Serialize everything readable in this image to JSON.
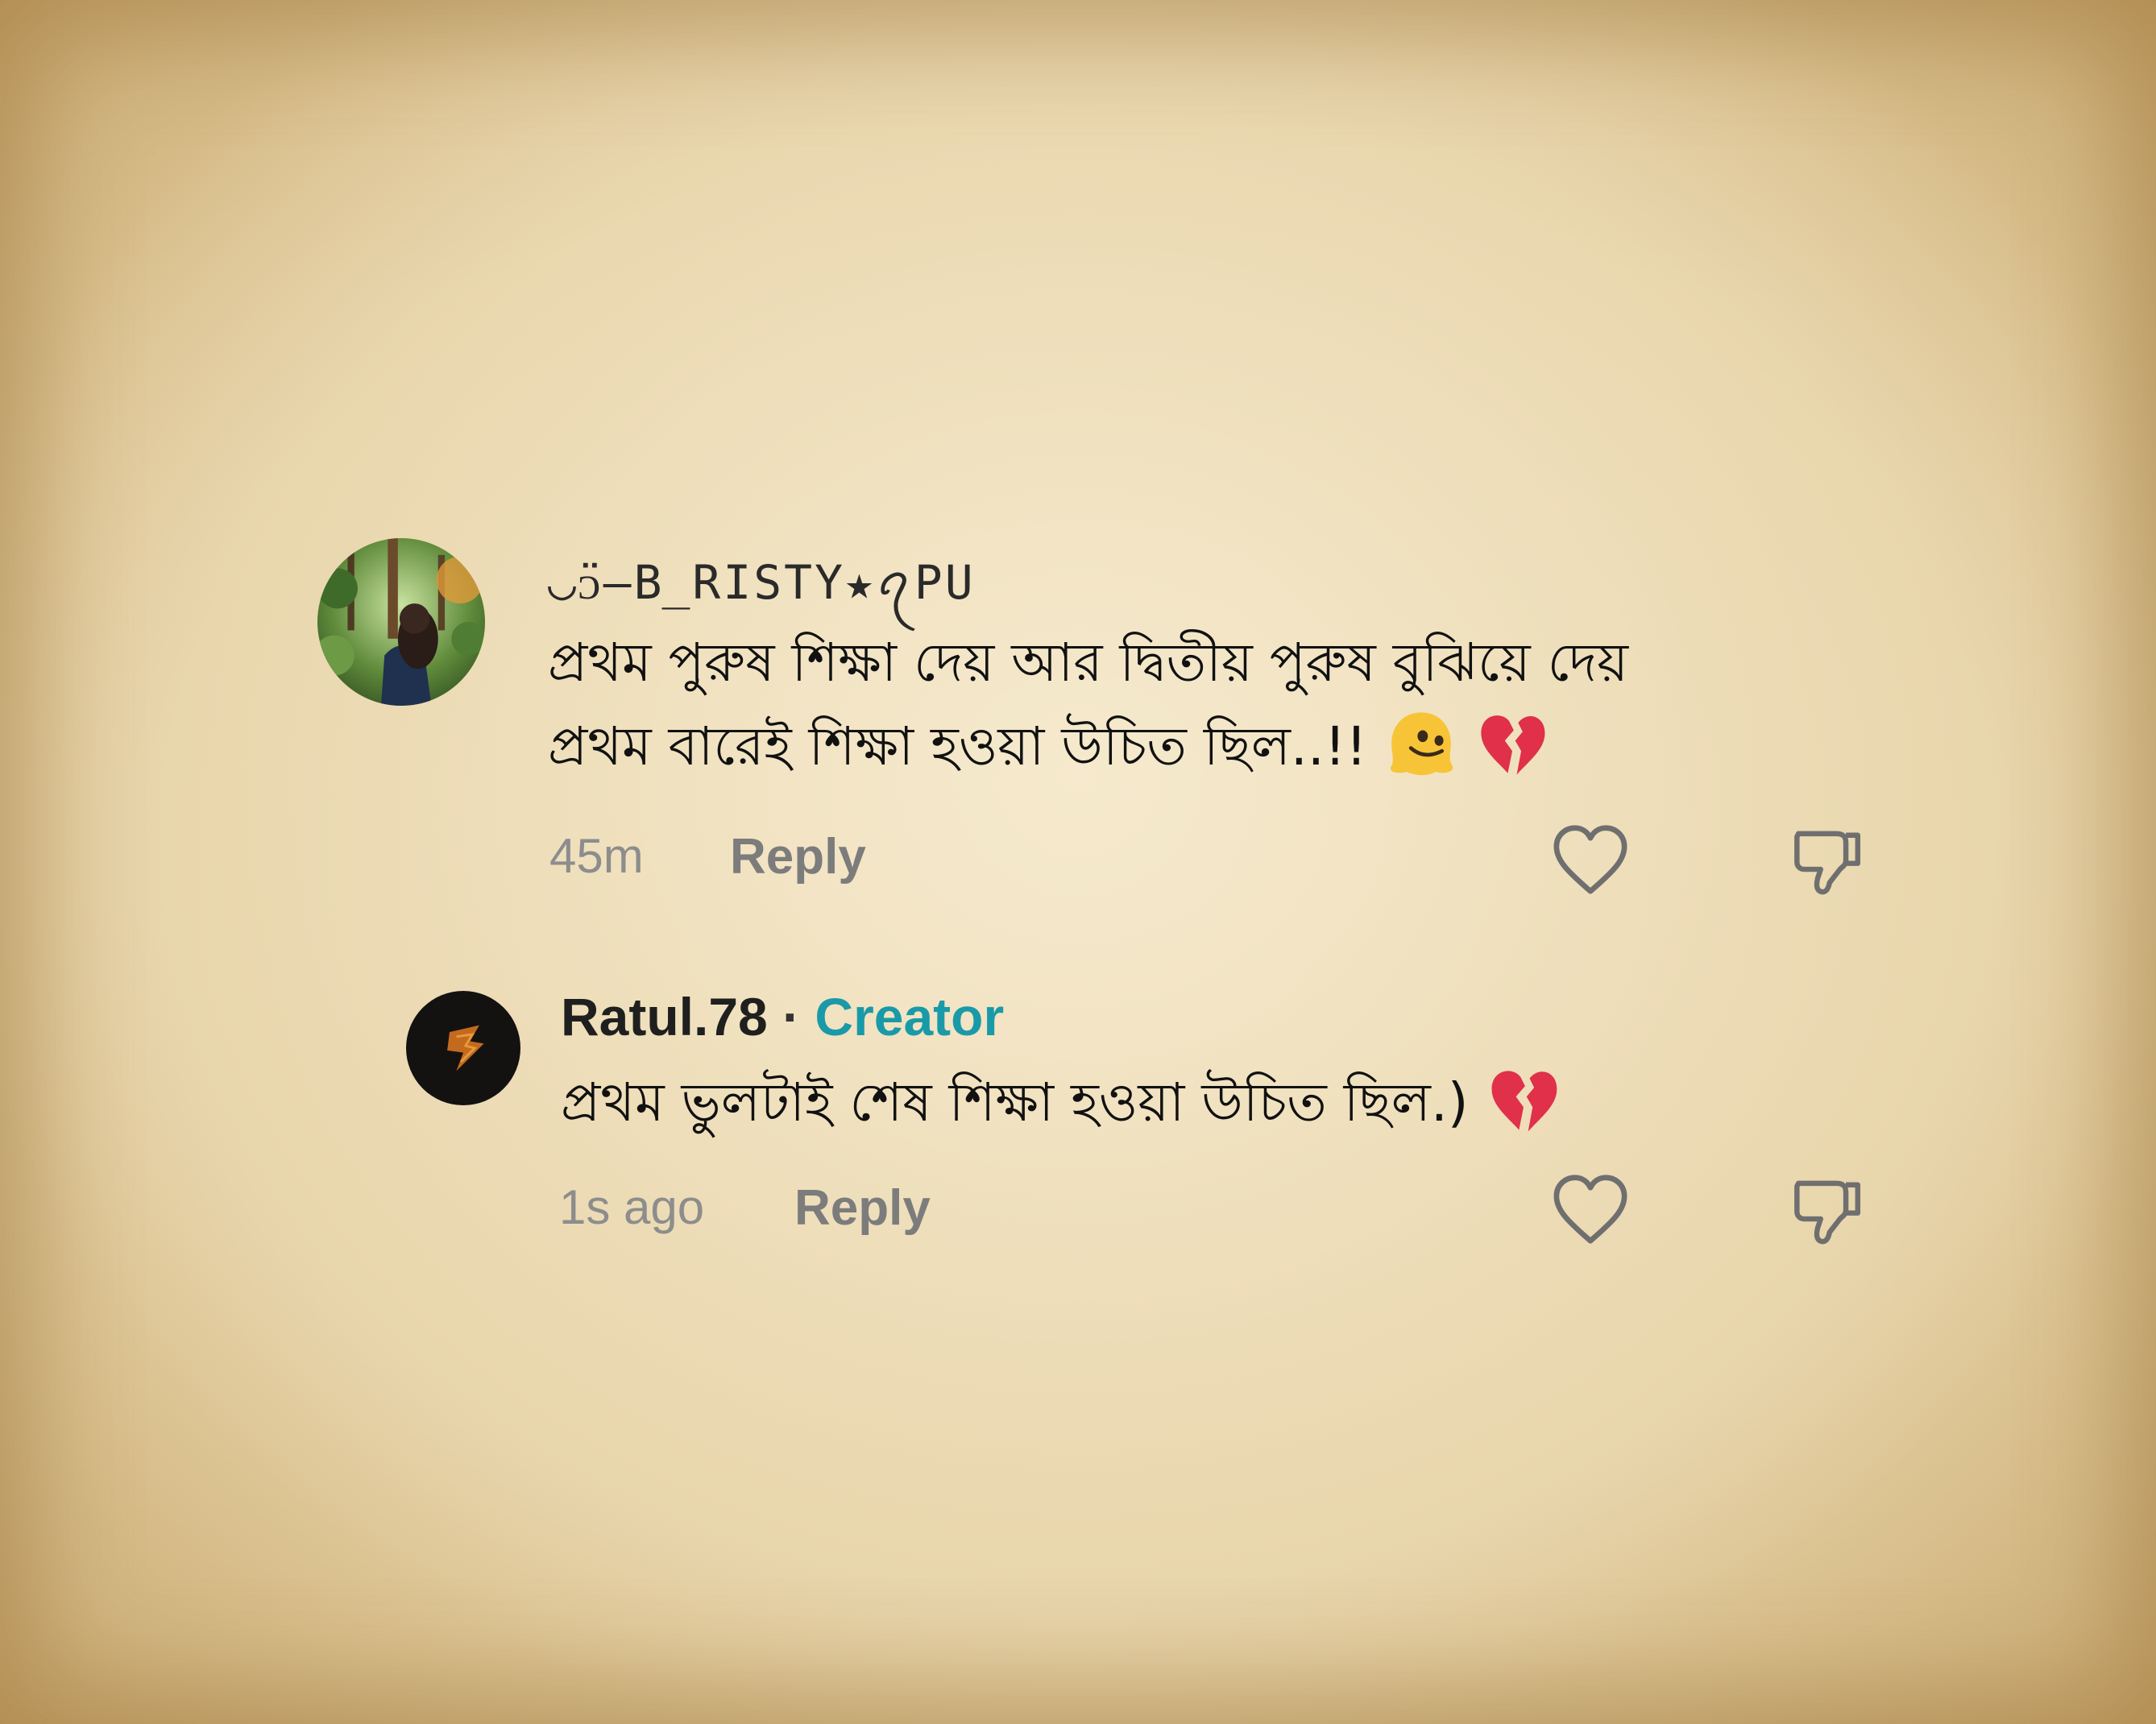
{
  "comments": [
    {
      "username": "◡̈ᴐ—B̲RISTY★ꪖPU",
      "lines": [
        "প্রথম পুরুষ শিক্ষা দেয় আর দ্বিতীয় পুরুষ বুঝিয়ে দেয়",
        "প্রথম বারেই শিক্ষা হওয়া উচিত ছিল..!!"
      ],
      "emojis": [
        "melting-face",
        "broken-heart"
      ],
      "time": "45m",
      "reply_label": "Reply",
      "avatar_icon": "girl-in-forest-avatar"
    },
    {
      "username": "Ratul.78",
      "separator": "·",
      "badge": "Creator",
      "lines": [
        "প্রথম ভুলটাই শেষ শিক্ষা হওয়া উচিত ছিল.)"
      ],
      "emojis": [
        "broken-heart"
      ],
      "time": "1s ago",
      "reply_label": "Reply",
      "avatar_icon": "dark-logo-avatar"
    }
  ],
  "icons": {
    "like": "heart-icon",
    "dislike": "thumbs-down-icon"
  },
  "colors": {
    "background": "#ecdcb6",
    "creator_badge": "#1a9aa8",
    "meta_text": "#8d8d8d",
    "reply_text": "#7c7c7c",
    "icon_stroke": "#6f6f6f",
    "broken_heart": "#e0304a",
    "melting_face": "#f7c437"
  }
}
